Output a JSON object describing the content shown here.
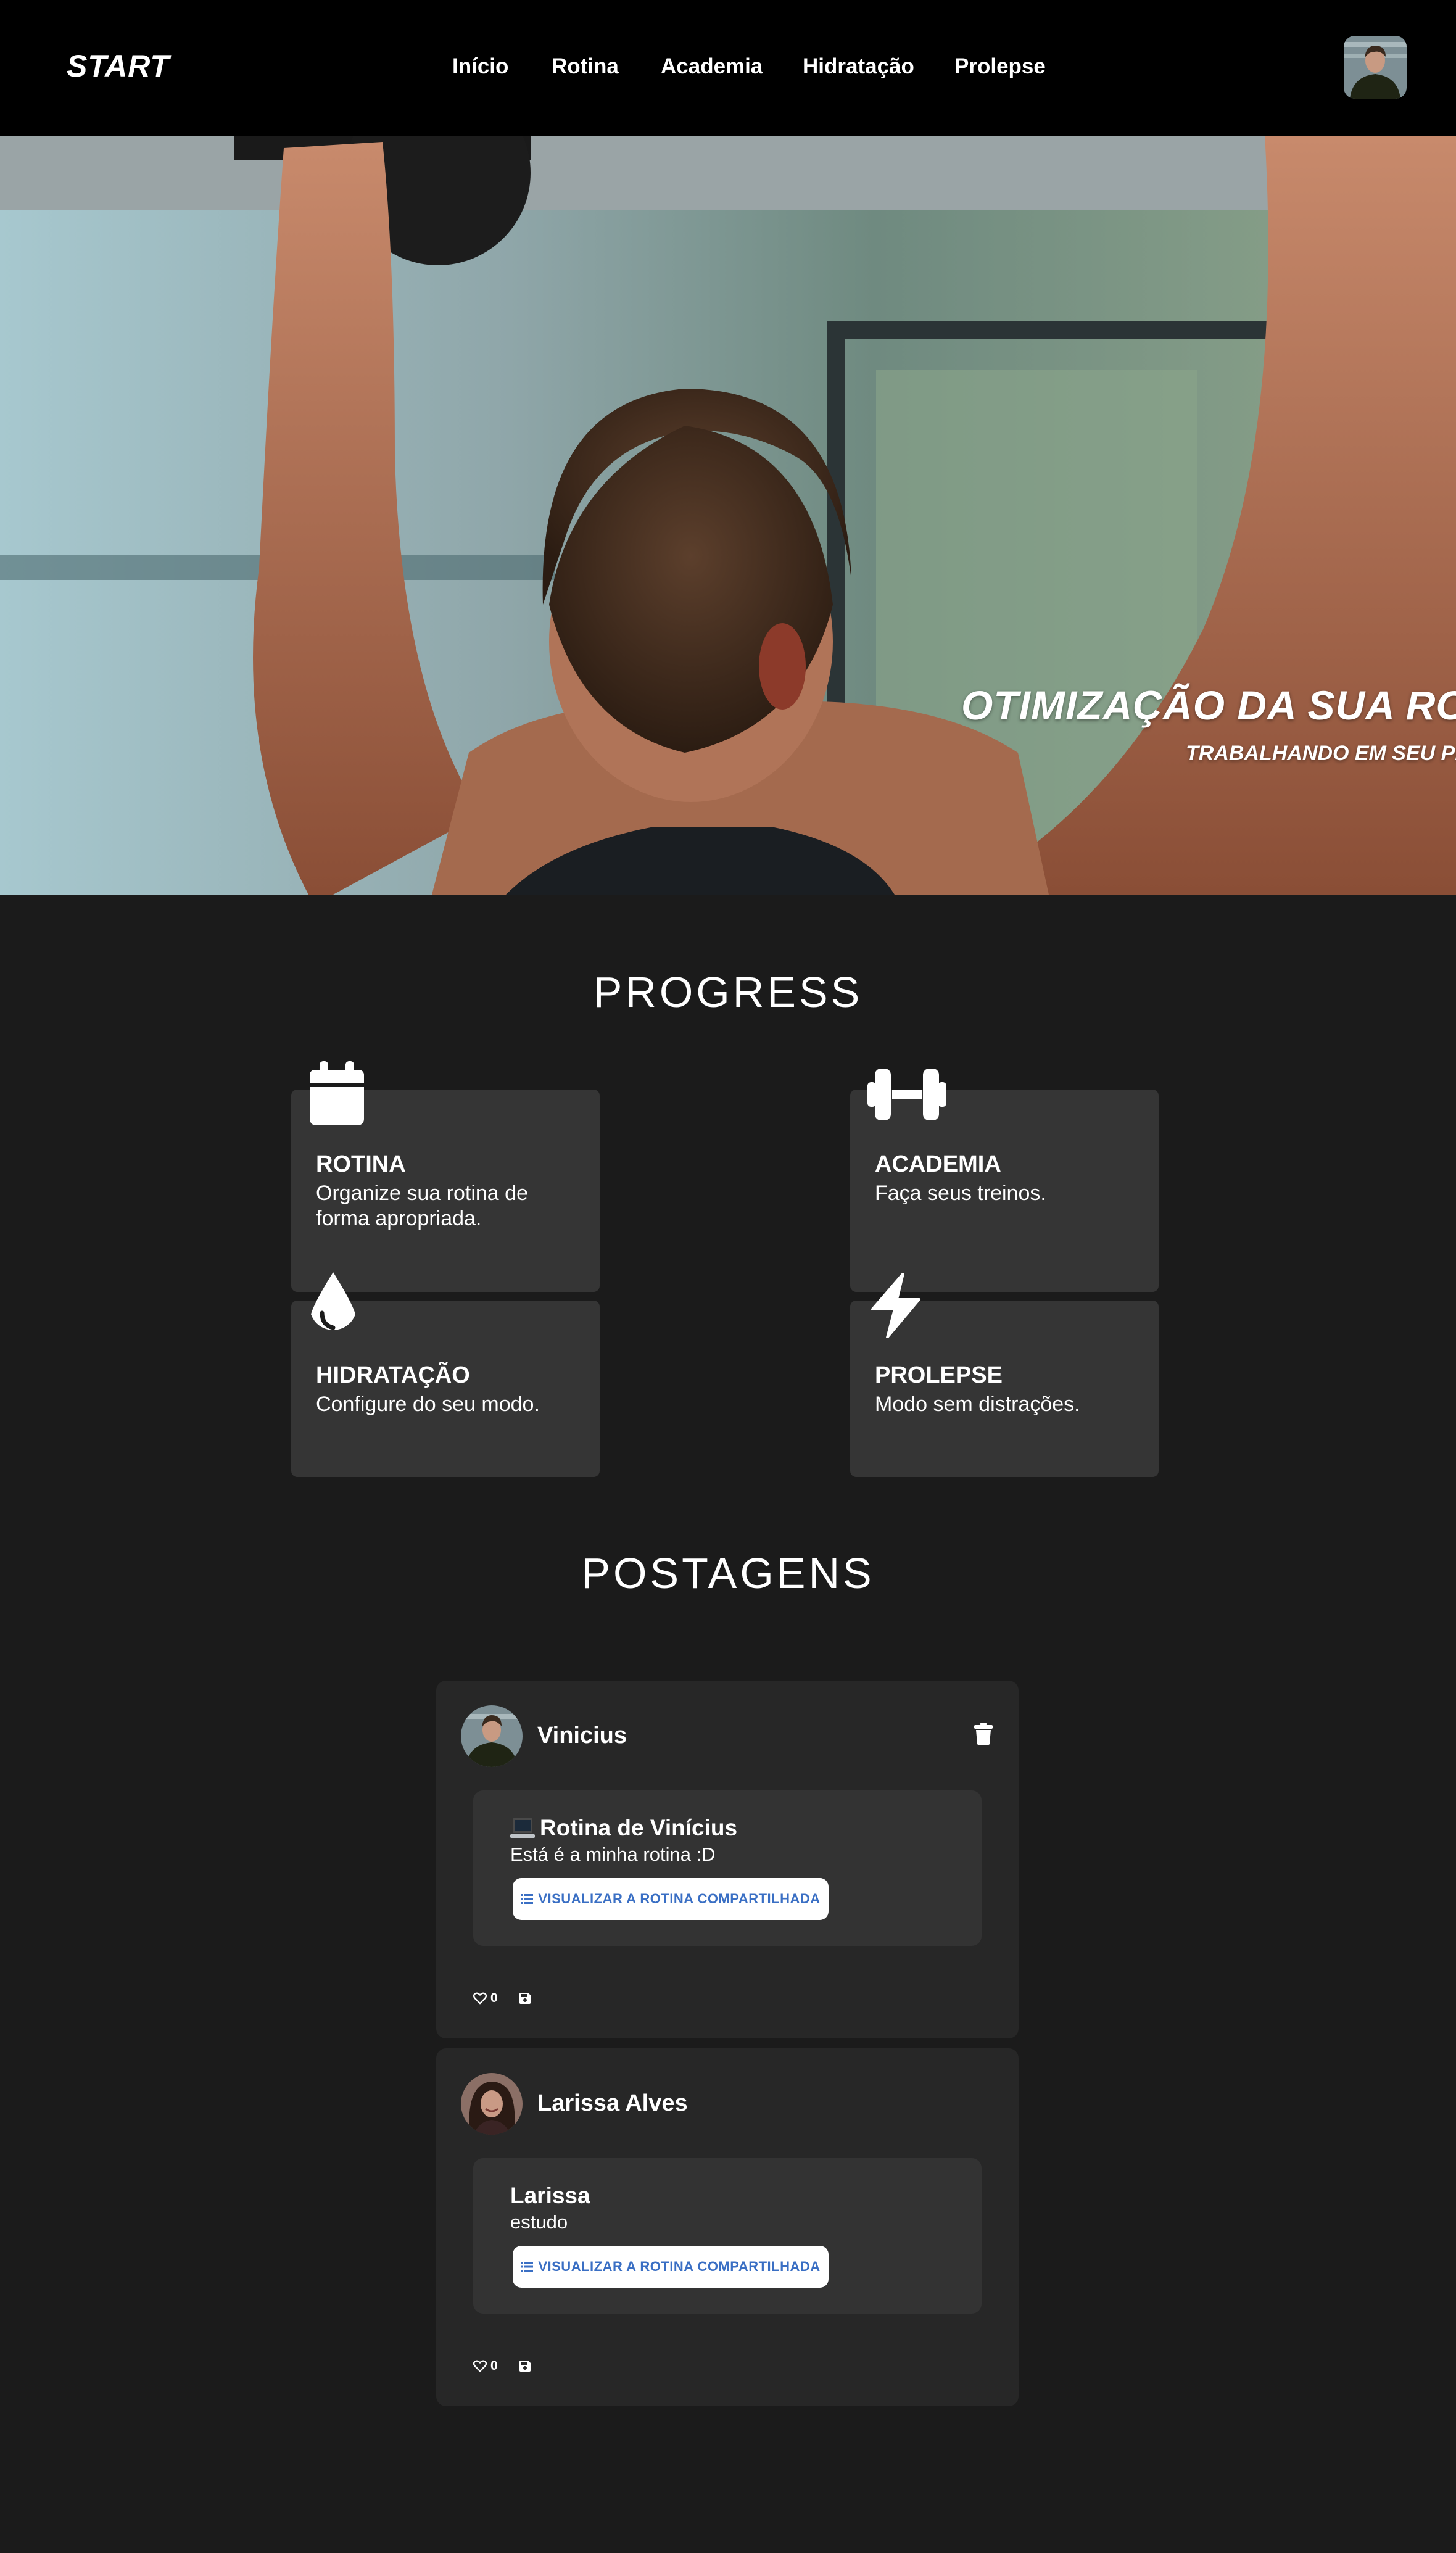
{
  "navbar": {
    "brand": "START",
    "links": [
      "Início",
      "Rotina",
      "Academia",
      "Hidratação",
      "Prolepse"
    ]
  },
  "hero": {
    "title": "OTIMIZAÇÃO DA SUA RO",
    "subtitle": "TRABALHANDO EM SEU PR"
  },
  "progress": {
    "heading": "PROGRESS",
    "cards": [
      {
        "title": "ROTINA",
        "description": "Organize sua rotina de forma apropriada.",
        "icon": "calendar-icon"
      },
      {
        "title": "ACADEMIA",
        "description": "Faça seus treinos.",
        "icon": "dumbbell-icon"
      },
      {
        "title": "HIDRATAÇÃO",
        "description": "Configure do seu modo.",
        "icon": "water-drop-icon"
      },
      {
        "title": "PROLEPSE",
        "description": "Modo sem distrações.",
        "icon": "lightning-icon"
      }
    ]
  },
  "posts": {
    "heading": "POSTAGENS",
    "items": [
      {
        "author": "Vinicius",
        "title": "Rotina de Vinícius",
        "text": "Está é a minha rotina :D",
        "button": "VISUALIZAR A ROTINA COMPARTILHADA",
        "likes": "0",
        "has_delete": true
      },
      {
        "author": "Larissa Alves",
        "title": "Larissa",
        "text": "estudo",
        "button": "VISUALIZAR A ROTINA COMPARTILHADA",
        "likes": "0",
        "has_delete": false
      }
    ]
  },
  "colors": {
    "page_bg": "#1b1b1b",
    "navbar_bg": "#000000",
    "card_bg": "#353535",
    "post_bg": "#272727",
    "post_inner_bg": "#333333",
    "button_text": "#3a6fc4"
  }
}
